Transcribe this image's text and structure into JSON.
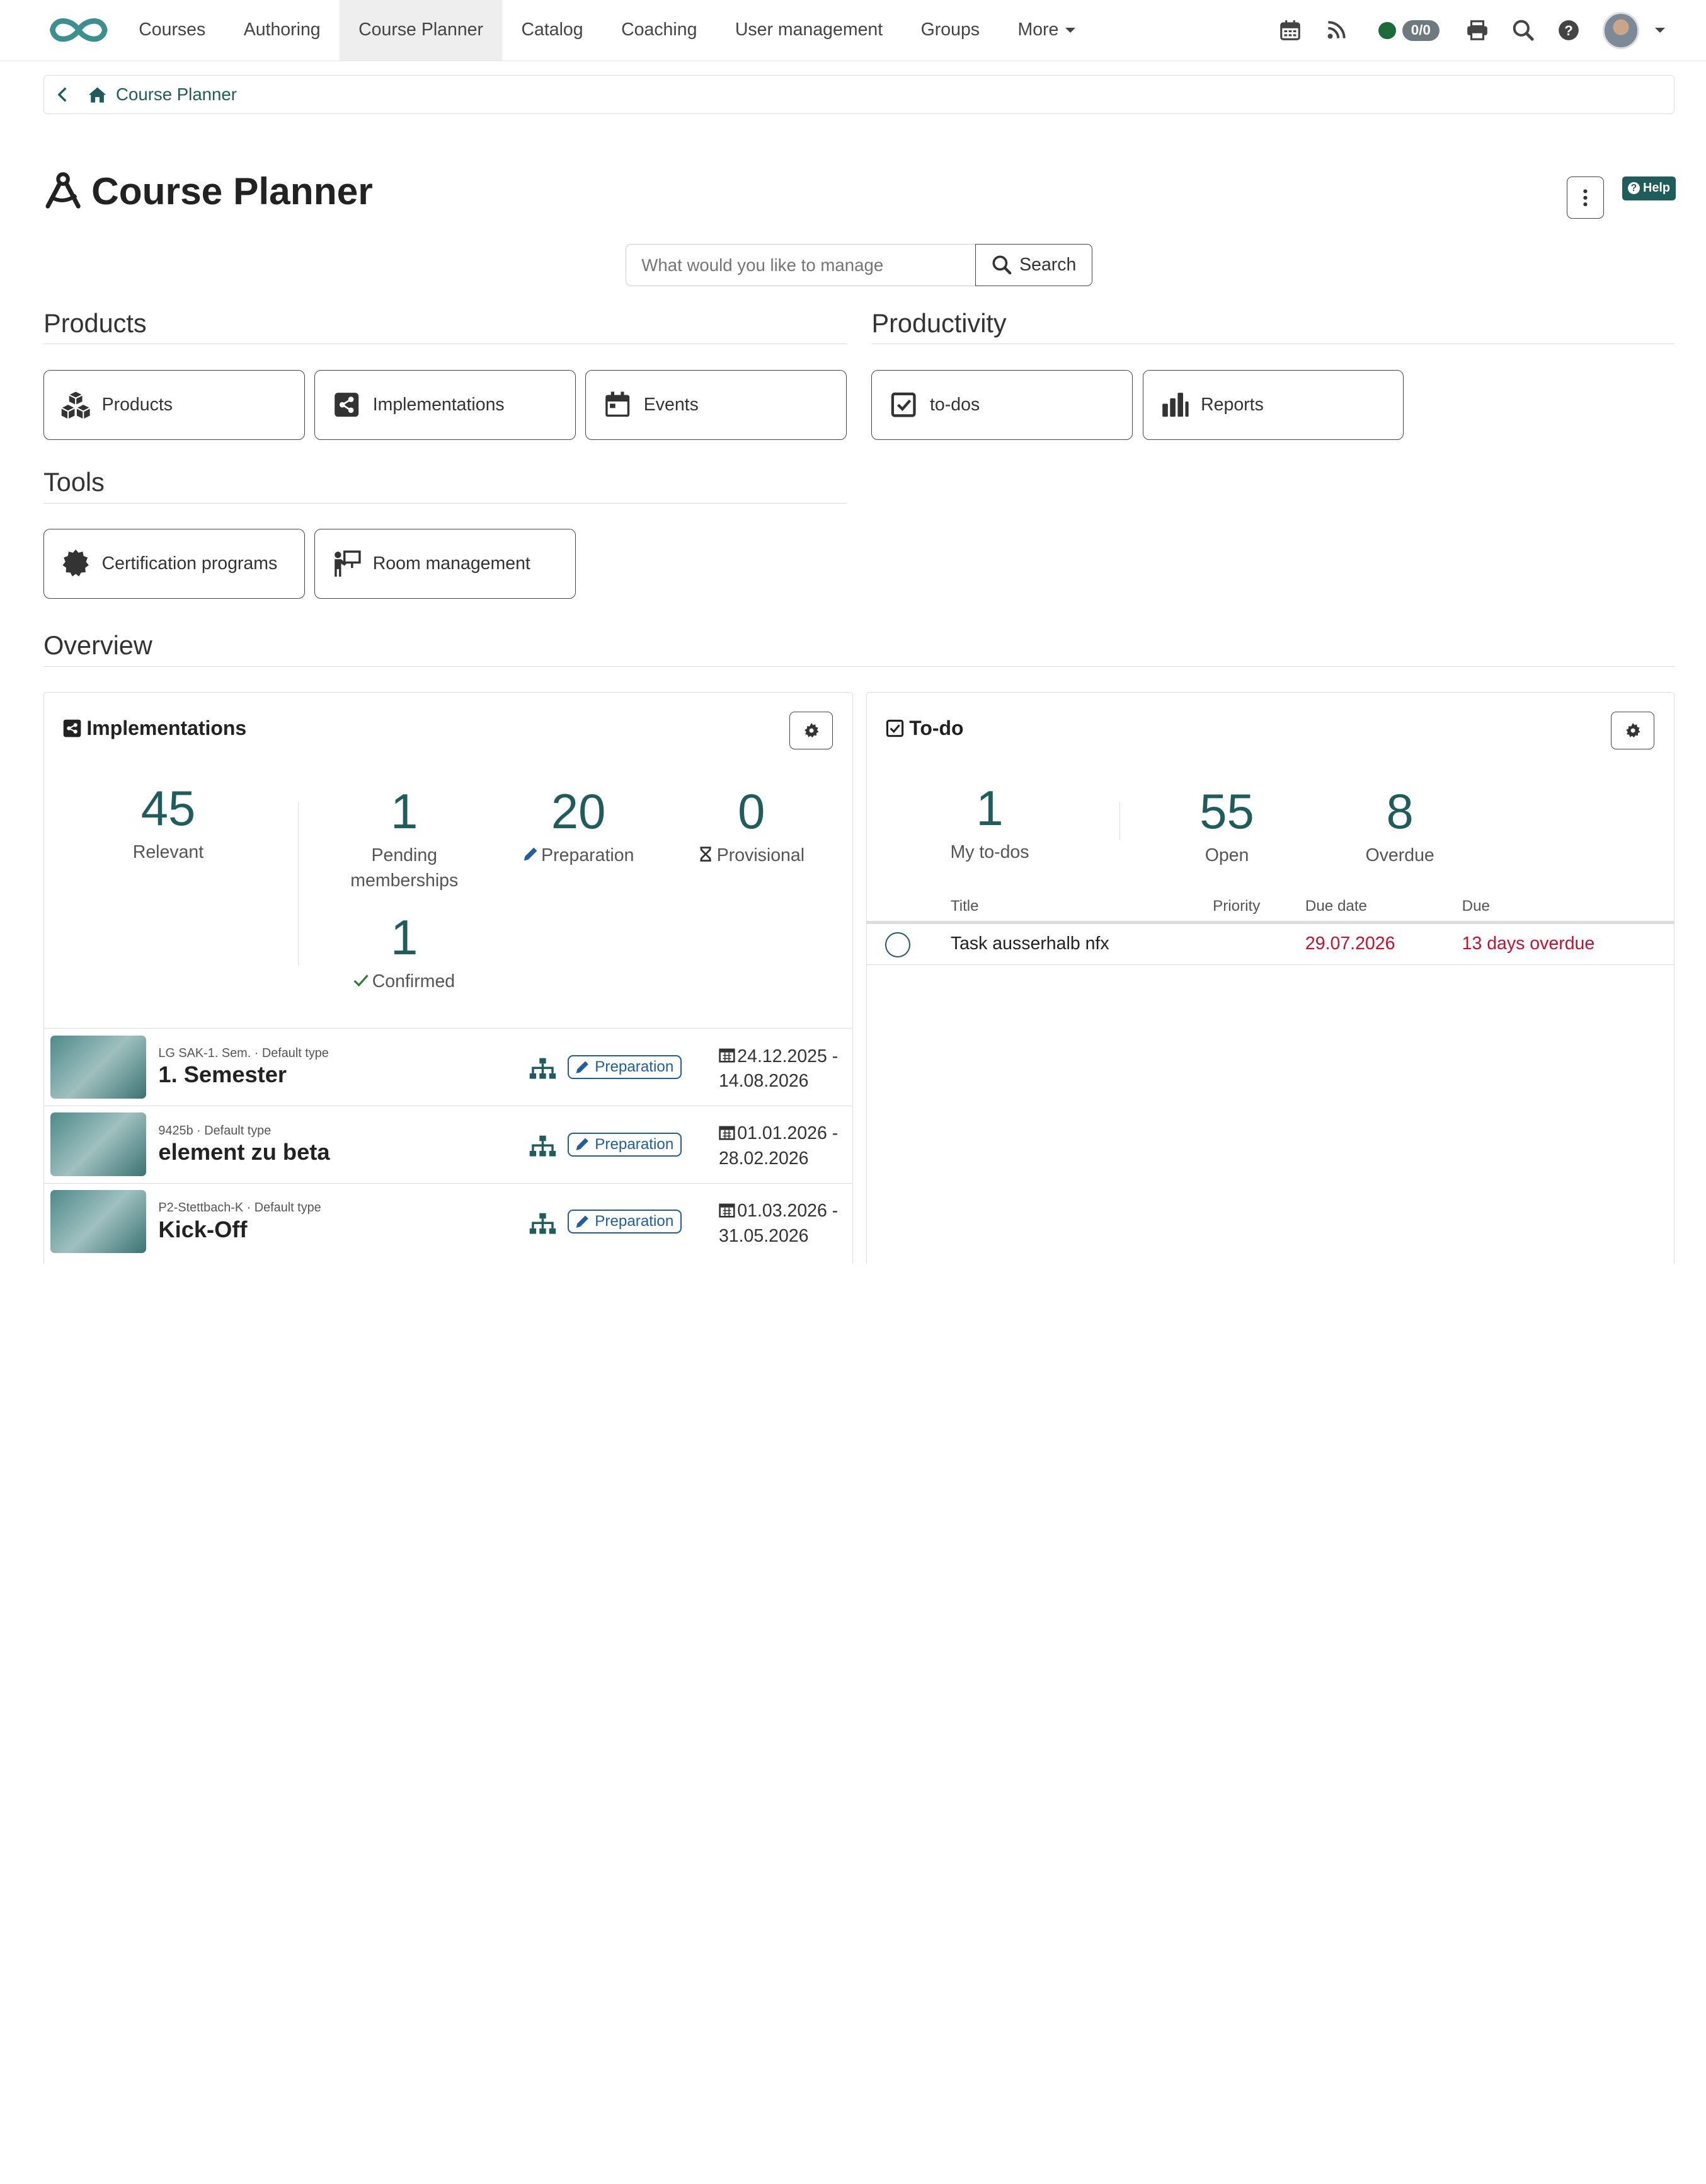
{
  "nav": {
    "items": [
      {
        "label": "Courses"
      },
      {
        "label": "Authoring"
      },
      {
        "label": "Course Planner"
      },
      {
        "label": "Catalog"
      },
      {
        "label": "Coaching"
      },
      {
        "label": "User management"
      },
      {
        "label": "Groups"
      },
      {
        "label": "More"
      }
    ],
    "active_index": 2,
    "badge": "0/0",
    "status_color": "#1e6b3a"
  },
  "breadcrumb": {
    "label": "Course Planner"
  },
  "page": {
    "title": "Course Planner",
    "help_label": "Help"
  },
  "search": {
    "placeholder": "What would you like to manage",
    "button_label": "Search"
  },
  "sections": {
    "products": {
      "title": "Products",
      "tiles": [
        {
          "label": "Products",
          "icon": "cubes-icon"
        },
        {
          "label": "Implementations",
          "icon": "share-square-icon"
        },
        {
          "label": "Events",
          "icon": "calendar-icon"
        }
      ]
    },
    "productivity": {
      "title": "Productivity",
      "tiles": [
        {
          "label": "to-dos",
          "icon": "check-square-icon"
        },
        {
          "label": "Reports",
          "icon": "bar-chart-icon"
        }
      ]
    },
    "tools": {
      "title": "Tools",
      "tiles": [
        {
          "label": "Certification programs",
          "icon": "certificate-icon"
        },
        {
          "label": "Room management",
          "icon": "presenter-icon"
        }
      ]
    },
    "overview": {
      "title": "Overview"
    }
  },
  "implementations_panel": {
    "title": "Implementations",
    "stats": {
      "relevant": {
        "value": "45",
        "label": "Relevant"
      },
      "pending": {
        "value": "1",
        "label_line1": "Pending",
        "label_line2": "memberships"
      },
      "preparation": {
        "value": "20",
        "label": "Preparation"
      },
      "provisional": {
        "value": "0",
        "label": "Provisional"
      },
      "confirmed": {
        "value": "1",
        "label": "Confirmed"
      }
    },
    "rows": [
      {
        "meta": "LG SAK-1. Sem. · Default type",
        "title": "1. Semester",
        "status": "Preparation",
        "date_start": "24.12.2025 -",
        "date_end": "14.08.2026"
      },
      {
        "meta": "9425b · Default type",
        "title": "element zu beta",
        "status": "Preparation",
        "date_start": "01.01.2026 -",
        "date_end": "28.02.2026"
      },
      {
        "meta": "P2-Stettbach-K · Default type",
        "title": "Kick-Off",
        "status": "Preparation",
        "date_start": "01.03.2026 -",
        "date_end": "31.05.2026"
      }
    ]
  },
  "todo_panel": {
    "title": "To-do",
    "stats": {
      "my": {
        "value": "1",
        "label": "My to-dos"
      },
      "open": {
        "value": "55",
        "label": "Open"
      },
      "overdue": {
        "value": "8",
        "label": "Overdue"
      }
    },
    "columns": {
      "title": "Title",
      "priority": "Priority",
      "due_date": "Due date",
      "due": "Due"
    },
    "rows": [
      {
        "title": "Task ausserhalb nfx",
        "priority": "",
        "due_date": "29.07.2026",
        "due": "13 days overdue"
      }
    ],
    "overdue_color": "#c8102e"
  }
}
